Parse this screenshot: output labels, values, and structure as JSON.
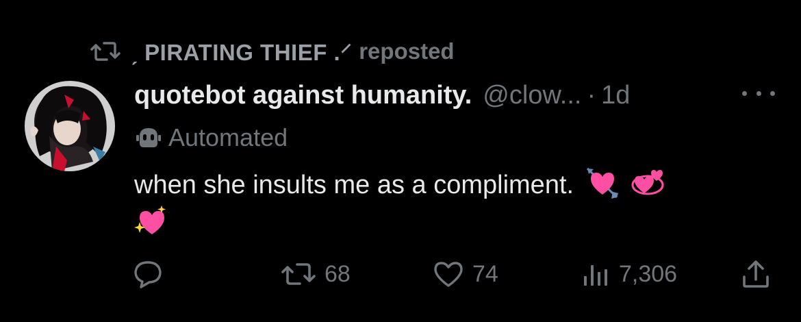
{
  "repost": {
    "reposter": "ˏ PIRATING THIEF .⸍",
    "label": "reposted"
  },
  "post": {
    "display_name": "quotebot against humanity.",
    "handle": "@clow...",
    "separator": "·",
    "timestamp": "1d",
    "automated_label": "Automated",
    "text": "when she insults me as a compliment."
  },
  "actions": {
    "reply_count": "",
    "repost_count": "68",
    "like_count": "74",
    "views_count": "7,306"
  },
  "icons": {
    "repost": "repost-icon",
    "more": "more-icon",
    "bot": "bot-icon",
    "reply": "reply-icon",
    "like": "heart-icon",
    "views": "views-icon",
    "share": "share-icon",
    "emojis": [
      "heart-with-arrow",
      "revolving-hearts",
      "sparkling-heart"
    ]
  },
  "colors": {
    "background": "#000000",
    "primary_text": "#e7e9ea",
    "secondary_text": "#71767b",
    "emoji_pink": "#ff4fa3"
  }
}
